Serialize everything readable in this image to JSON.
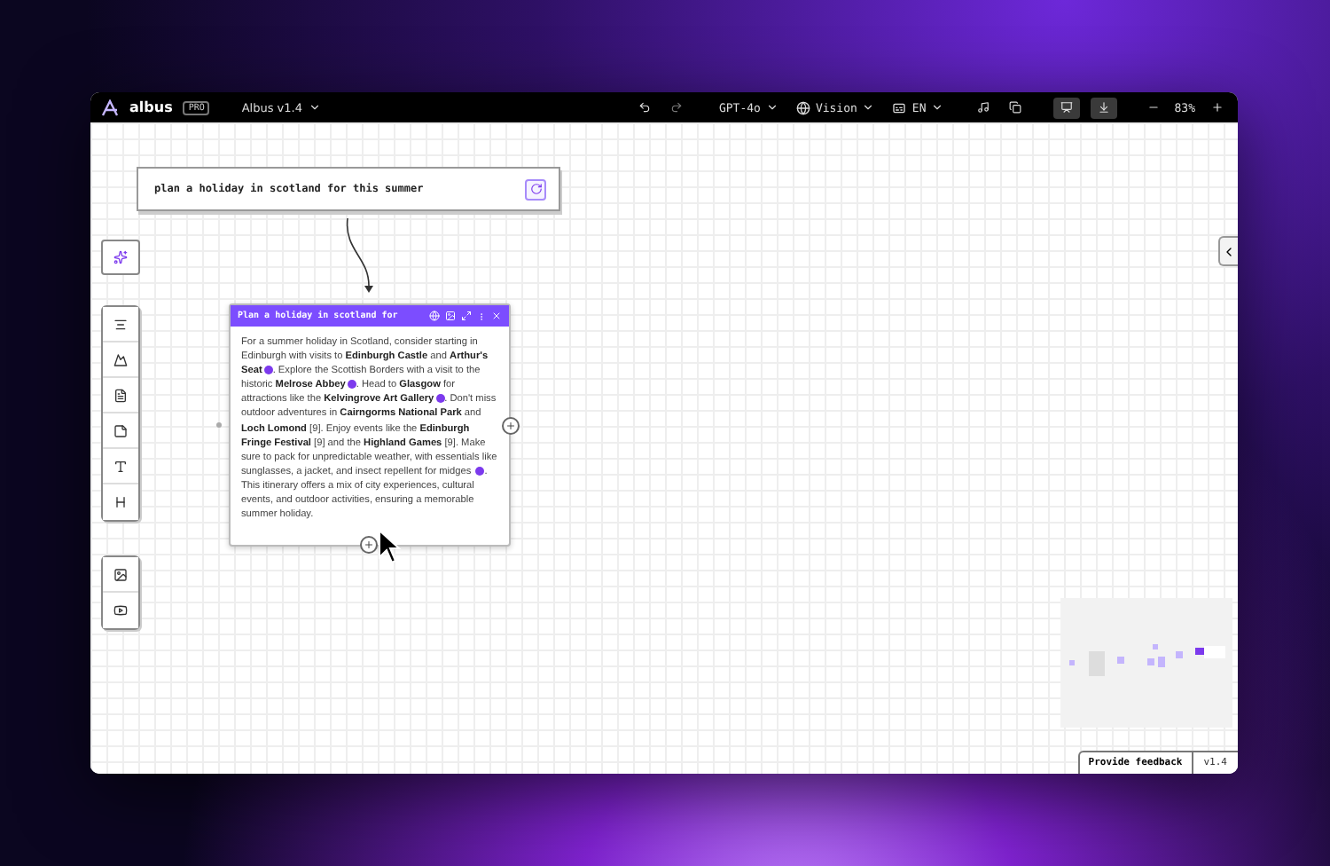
{
  "top_bar": {
    "logo_text": "albus",
    "plan_badge": "PRO",
    "project": "Albus v1.4",
    "model": "GPT-4o",
    "mode": "Vision",
    "language": "EN",
    "zoom": "83%"
  },
  "prompt_node": {
    "text": "plan a holiday in scotland for this summer"
  },
  "response_node": {
    "title": "Plan a holiday in scotland for",
    "segments": [
      {
        "kind": "text",
        "text": "For a summer holiday in Scotland, consider starting in Edinburgh with visits to "
      },
      {
        "kind": "bold",
        "text": "Edinburgh Castle"
      },
      {
        "kind": "text",
        "text": " and "
      },
      {
        "kind": "bold",
        "text": "Arthur's Seat"
      },
      {
        "kind": "cite"
      },
      {
        "kind": "text",
        "text": ". Explore the Scottish Borders with a visit to the historic "
      },
      {
        "kind": "bold",
        "text": "Melrose Abbey"
      },
      {
        "kind": "cite"
      },
      {
        "kind": "text",
        "text": ". Head to "
      },
      {
        "kind": "bold",
        "text": "Glasgow"
      },
      {
        "kind": "text",
        "text": " for attractions like the "
      },
      {
        "kind": "bold",
        "text": "Kelvingrove Art Gallery"
      },
      {
        "kind": "cite"
      },
      {
        "kind": "text",
        "text": ". Don't miss outdoor adventures in "
      },
      {
        "kind": "bold",
        "text": "Cairngorms National Park"
      },
      {
        "kind": "text",
        "text": " and "
      },
      {
        "kind": "bold",
        "text": "Loch Lomond"
      },
      {
        "kind": "text",
        "text": " [9]. Enjoy events like the "
      },
      {
        "kind": "bold",
        "text": "Edinburgh Fringe Festival"
      },
      {
        "kind": "text",
        "text": " [9] and the "
      },
      {
        "kind": "bold",
        "text": "Highland Games"
      },
      {
        "kind": "text",
        "text": " [9]. Make sure to pack for unpredictable weather, with essentials like sunglasses, a jacket, and insect repellent for midges "
      },
      {
        "kind": "cite"
      },
      {
        "kind": "text",
        "text": ". This itinerary offers a mix of city experiences, cultural events, and outdoor activities, ensuring a memorable summer holiday."
      }
    ]
  },
  "footer": {
    "feedback": "Provide feedback",
    "version": "v1.4"
  }
}
